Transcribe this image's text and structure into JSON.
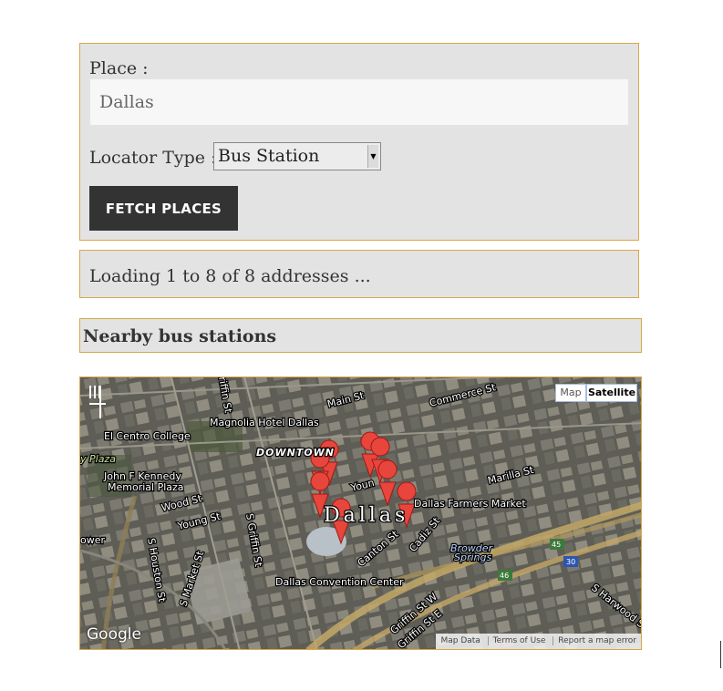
{
  "form": {
    "place_label": "Place :",
    "place_value": "Dallas",
    "locator_label": "Locator Type :",
    "locator_value": "Bus Station",
    "fetch_button": "FETCH PLACES"
  },
  "status": {
    "text": "Loading 1 to 8 of 8 addresses ..."
  },
  "results": {
    "heading": "Nearby bus stations"
  },
  "map": {
    "type_buttons": {
      "map": "Map",
      "satellite": "Satellite"
    },
    "logo": "Google",
    "attribution": [
      "Map Data",
      "Terms of Use",
      "Report a map error"
    ],
    "center_label": "Dallas",
    "labels": {
      "main_st": "Main St",
      "commerce_st": "Commerce St",
      "magnolia": "Magnolia Hotel Dallas",
      "el_centro": "El Centro College",
      "downtown": "DOWNTOWN",
      "plaza": "y Plaza",
      "jfk1": "John F Kennedy",
      "jfk2": "Memorial Plaza",
      "wood_st": "Wood St",
      "young_st1": "Young St",
      "young_st2": "Youn",
      "farmers": "Dallas Farmers Market",
      "marilla": "Marilla St",
      "canton": "Canton St",
      "cadiz": "Cadiz St",
      "browder1": "Browder",
      "browder2": "Springs",
      "convention": "Dallas Convention Center",
      "houston": "S Houston St",
      "market": "S Market St",
      "griffin_s": "S Griffin St",
      "griffin_n": "riffin St",
      "griffin_w": "Griffin St W",
      "griffin_e": "Griffin St E",
      "harwood": "S Harwood St",
      "tower": "ower",
      "hwy45": "45",
      "hwy30": "30",
      "hwy46": "46"
    },
    "colors": {
      "marker": "#e8453c",
      "border": "#d9a74a"
    }
  }
}
